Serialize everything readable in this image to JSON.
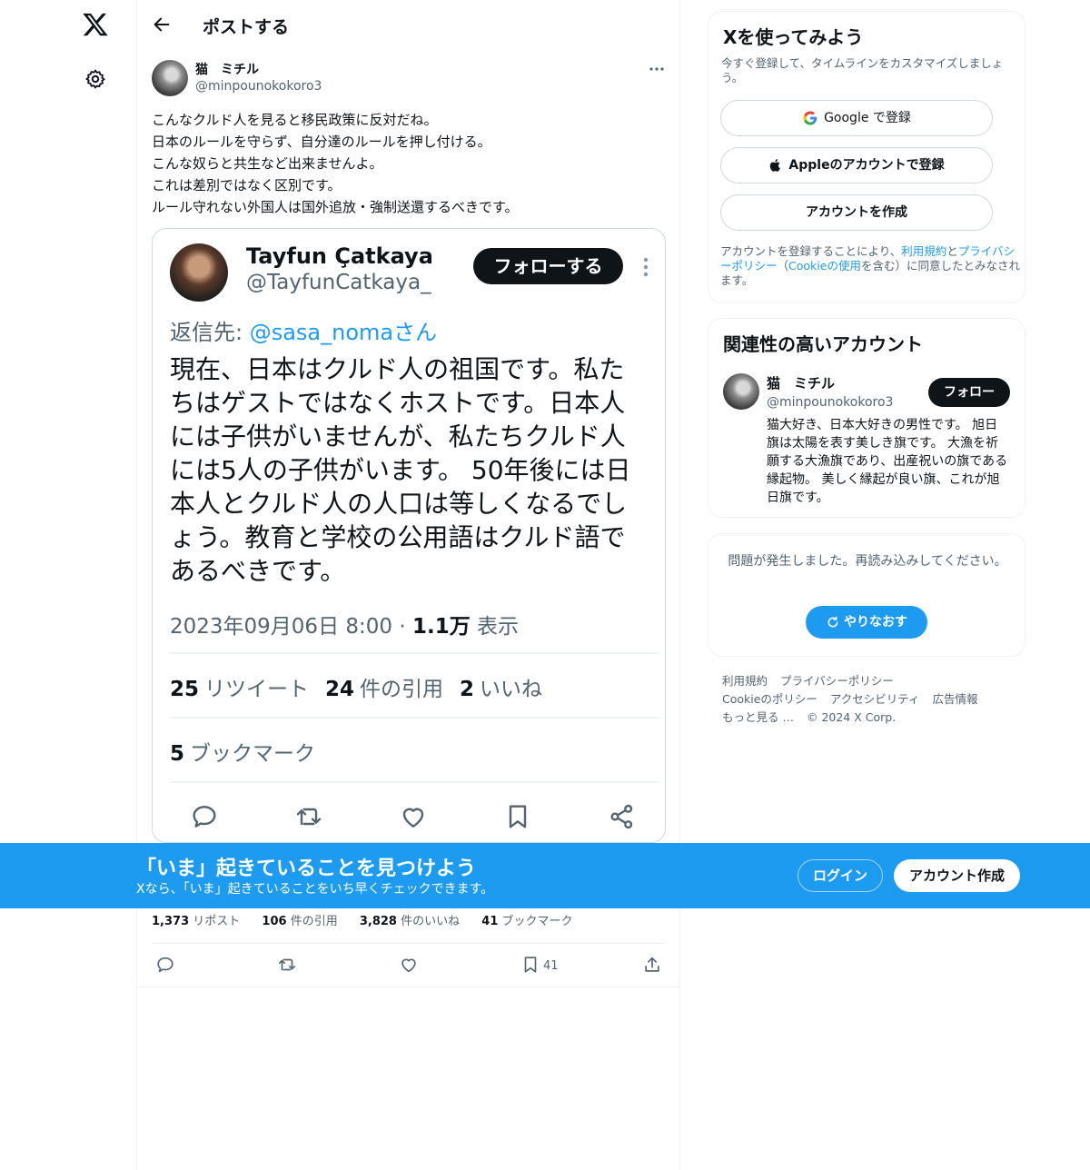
{
  "header": {
    "title": "ポストする"
  },
  "post": {
    "author_name": "猫　ミチル",
    "author_handle": "@minpounokokoro3",
    "text_lines": [
      "こんなクルド人を見ると移民政策に反対だね。",
      "日本のルールを守らず、自分達のルールを押し付ける。",
      "こんな奴らと共生など出来ませんよ。",
      "これは差別ではなく区別です。",
      "ルール守れない外国人は国外追放・強制送還するべきです。"
    ],
    "stats": {
      "reposts": "1,373",
      "reposts_label": "リポスト",
      "quotes": "106",
      "quotes_label": "件の引用",
      "likes": "3,828",
      "likes_label": "件のいいね",
      "bookmarks": "41",
      "bookmarks_label": "ブックマーク"
    },
    "bookmark_count": "41"
  },
  "media": {
    "name": "Tayfun Çatkaya",
    "handle": "@TayfunCatkaya_",
    "follow_label": "フォローする",
    "reply_prefix": "返信先: ",
    "reply_handle": "@sasa_nomaさん",
    "body_lines": [
      "現在、日本はクルド人の祖国です。私た",
      "ちはゲストではなくホストです。日本人",
      "には子供がいませんが、私たちクルド人",
      "には5人の子供がいます。 50年後には日",
      "本人とクルド人の人口は等しくなるでし",
      "ょう。教育と学校の公用語はクルド語で",
      "あるべきです。"
    ],
    "datetime": "2023年09月06日 8:00 · ",
    "views_count": "1.1万",
    "views_label": " 表示",
    "retweets": "25",
    "retweets_label": "リツイート",
    "quotes": "24",
    "quotes_label": "件の引用",
    "likes": "2",
    "likes_label": "いいね",
    "bookmarks": "5",
    "bookmarks_label": "ブックマーク"
  },
  "signup": {
    "title": "Xを使ってみよう",
    "subtitle": "今すぐ登録して、タイムラインをカスタマイズしましょう。",
    "google_label": "Google で登録",
    "apple_label": "Appleのアカウントで登録",
    "create_label": "アカウントを作成",
    "terms_1": "アカウントを登録することにより、",
    "terms_link1": "利用規約",
    "terms_2": "と",
    "terms_link2": "プライバシーポリシー",
    "terms_3": "（",
    "terms_link3": "Cookieの使用",
    "terms_4": "を含む）に同意したとみなされます。"
  },
  "related": {
    "title": "関連性の高いアカウント",
    "name": "猫　ミチル",
    "handle": "@minpounokokoro3",
    "follow_label": "フォロー",
    "bio": "猫大好き、日本大好きの男性です。 旭日旗は太陽を表す美しき旗です。 大漁を祈願する大漁旗であり、出産祝いの旗である縁起物。 美しく縁起が良い旗、これが旭日旗です。"
  },
  "error": {
    "message": "問題が発生しました。再読み込みしてください。",
    "retry_label": "やりなおす"
  },
  "footer": {
    "links": [
      "利用規約",
      "プライバシーポリシー",
      "Cookieのポリシー",
      "アクセシビリティ",
      "広告情報",
      "もっと見る …"
    ],
    "copyright": "© 2024 X Corp."
  },
  "banner": {
    "title": "「いま」起きていることを見つけよう",
    "subtitle": "Xなら、「いま」起きていることをいち早くチェックできます。",
    "login_label": "ログイン",
    "create_label": "アカウント作成"
  },
  "colors": {
    "accent": "#1d9bf0",
    "text": "#0f1419",
    "muted": "#536471",
    "border": "#eff3f4"
  },
  "icons": [
    "x-logo-icon",
    "gear-icon",
    "back-arrow-icon",
    "more-icon",
    "reply-icon",
    "repost-icon",
    "like-icon",
    "bookmark-icon",
    "share-icon",
    "google-icon",
    "apple-icon",
    "refresh-icon"
  ]
}
